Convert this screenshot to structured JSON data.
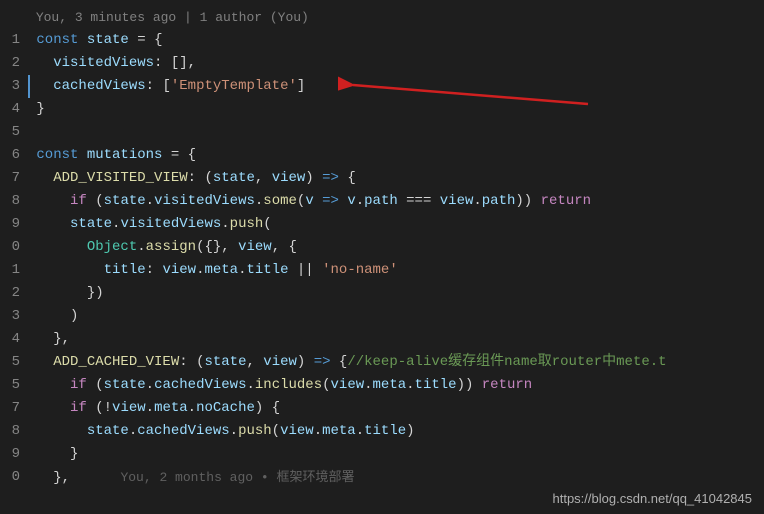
{
  "annotation_top": "You, 3 minutes ago | 1 author (You)",
  "lines": {
    "l1": {
      "num": "1"
    },
    "l2": {
      "num": "2"
    },
    "l3": {
      "num": "3"
    },
    "l4": {
      "num": "4"
    },
    "l5": {
      "num": "5"
    },
    "l6": {
      "num": "6"
    },
    "l7": {
      "num": "7"
    },
    "l8": {
      "num": "8"
    },
    "l9": {
      "num": "9"
    },
    "l10": {
      "num": "0"
    },
    "l11": {
      "num": "1"
    },
    "l12": {
      "num": "2"
    },
    "l13": {
      "num": "3"
    },
    "l14": {
      "num": "4"
    },
    "l15": {
      "num": "5"
    },
    "l16": {
      "num": "5"
    },
    "l17": {
      "num": "7"
    },
    "l18": {
      "num": "8"
    },
    "l19": {
      "num": "9"
    },
    "l20": {
      "num": "0"
    }
  },
  "tokens": {
    "const1": "const",
    "state": "state",
    "eq": " = ",
    "lbrace": "{",
    "visitedViews": "visitedViews",
    "colon": ":",
    "emptyArr": " []",
    "comma": ",",
    "cachedViews": "cachedViews",
    "emptyTemplate": "'EmptyTemplate'",
    "rbracket": "]",
    "rbrace": "}",
    "mutations": "mutations",
    "addVisited": "ADD_VISITED_VIEW",
    "arrow": " => ",
    "lparen": "(",
    "rparen": ")",
    "stateParam": "state",
    "viewParam": "view",
    "if": "if",
    "some": "some",
    "v": "v",
    "path": "path",
    "tripleEq": " === ",
    "return": "return",
    "push": "push",
    "Object": "Object",
    "assign": "assign",
    "emptyObj": "{}",
    "title": "title",
    "meta": "meta",
    "or": " || ",
    "noname": "'no-name'",
    "addCached": "ADD_CACHED_VIEW",
    "comment1": "//keep-alive缓存组件name取router中mete.t",
    "includes": "includes",
    "not": "!",
    "noCache": "noCache",
    "lbracket": "[",
    "dot": "."
  },
  "blame": {
    "who": "You, 2 months ago",
    "sep": " • ",
    "msg": "框架环境部署"
  },
  "watermark": "https://blog.csdn.net/qq_41042845"
}
